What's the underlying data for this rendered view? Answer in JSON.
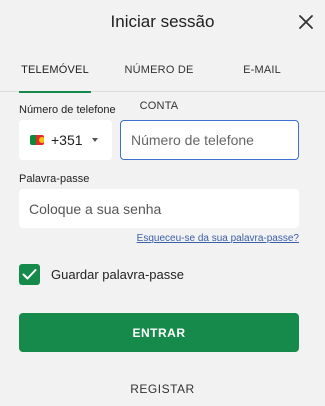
{
  "header": {
    "title": "Iniciar sessão",
    "close_icon": "close-icon"
  },
  "tabs": [
    {
      "label": "TELEMÓVEL",
      "active": true
    },
    {
      "label": "NÚMERO DE CONTA",
      "active": false
    },
    {
      "label": "E-MAIL",
      "active": false
    }
  ],
  "phone": {
    "label": "Número de telefone",
    "country_flag": "portugal-flag-icon",
    "country_code": "+351",
    "placeholder": "Número de telefone"
  },
  "password": {
    "label": "Palavra-passe",
    "placeholder": "Coloque a sua senha",
    "forgot": "Esqueceu-se da sua palavra-passe?"
  },
  "remember": {
    "label": "Guardar palavra-passe",
    "checked": true
  },
  "actions": {
    "enter": "ENTRAR",
    "register": "REGISTAR"
  },
  "colors": {
    "accent": "#168a4a",
    "focus_border": "#3d6fd6",
    "link": "#3b5ea8",
    "background": "#f2f2f2"
  }
}
